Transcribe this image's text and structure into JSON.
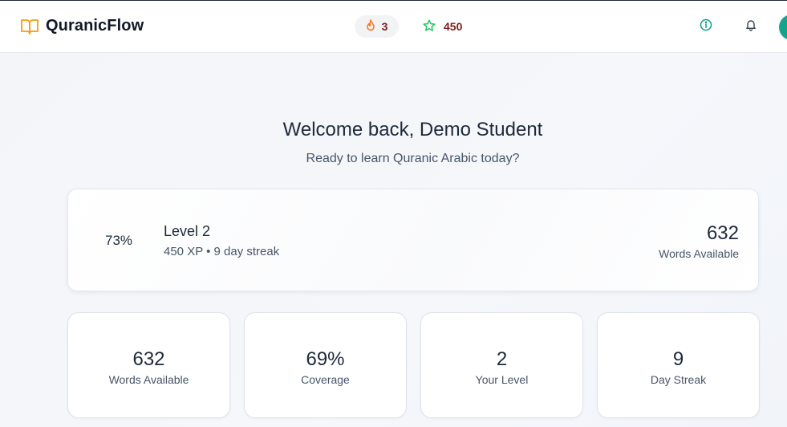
{
  "header": {
    "app_name": "QuranicFlow",
    "streak_count": "3",
    "xp_count": "450",
    "icons": {
      "logo": "book-open-icon",
      "streak": "flame-icon",
      "xp": "star-icon",
      "info": "info-icon",
      "notifications": "bell-icon"
    },
    "colors": {
      "logo": "#f59e0b",
      "flame": "#f97316",
      "star": "#22c55e",
      "info": "#0f9d8a",
      "avatar": "#14a38b"
    }
  },
  "welcome": {
    "title": "Welcome back, Demo Student",
    "subtitle": "Ready to learn Quranic Arabic today?"
  },
  "level_card": {
    "progress_percent": "73%",
    "level_title": "Level 2",
    "level_details": "450 XP • 9 day streak",
    "words_count": "632",
    "words_label": "Words Available"
  },
  "stats": [
    {
      "value": "632",
      "label": "Words Available"
    },
    {
      "value": "69%",
      "label": "Coverage"
    },
    {
      "value": "2",
      "label": "Your Level"
    },
    {
      "value": "9",
      "label": "Day Streak"
    }
  ]
}
